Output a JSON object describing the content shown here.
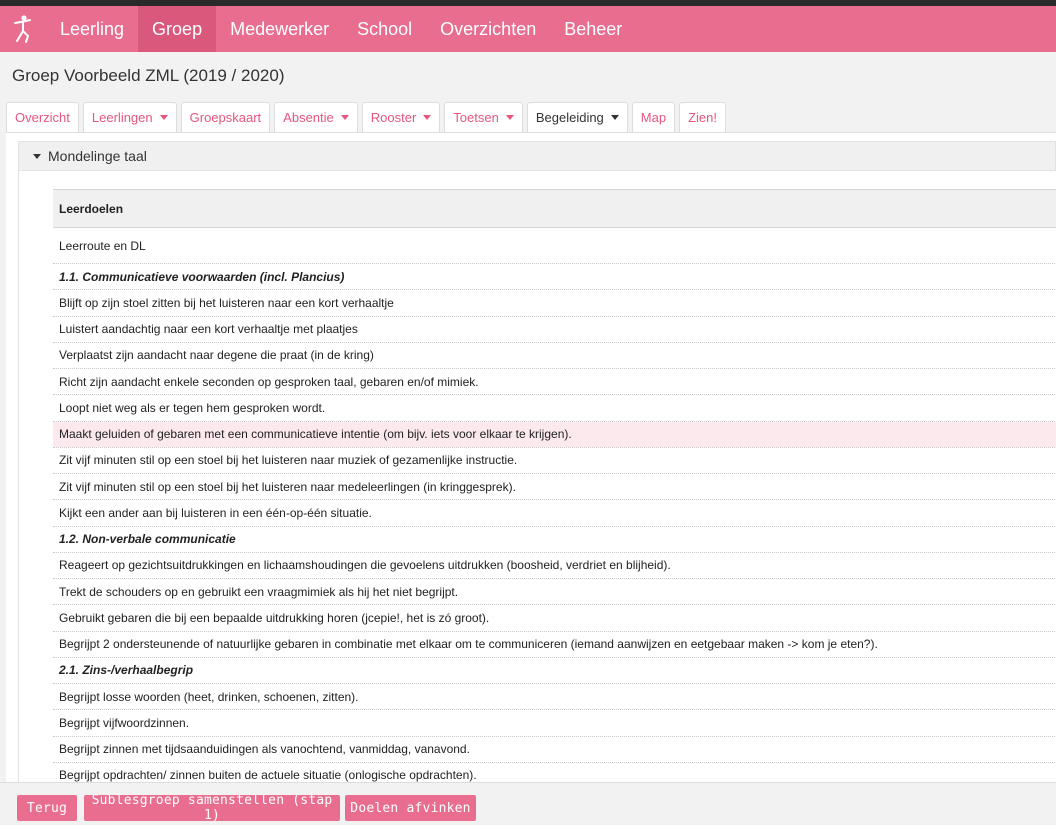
{
  "nav": {
    "items": [
      {
        "label": "Leerling"
      },
      {
        "label": "Groep"
      },
      {
        "label": "Medewerker"
      },
      {
        "label": "School"
      },
      {
        "label": "Overzichten"
      },
      {
        "label": "Beheer"
      }
    ],
    "active_index": 1,
    "accent_color": "#e96d8f",
    "logo_icon": "dancer-icon"
  },
  "page": {
    "title": "Groep Voorbeeld ZML (2019 / 2020)"
  },
  "tabs": [
    {
      "label": "Overzicht",
      "dropdown": false
    },
    {
      "label": "Leerlingen",
      "dropdown": true
    },
    {
      "label": "Groepskaart",
      "dropdown": false
    },
    {
      "label": "Absentie",
      "dropdown": true
    },
    {
      "label": "Rooster",
      "dropdown": true
    },
    {
      "label": "Toetsen",
      "dropdown": true
    },
    {
      "label": "Begeleiding",
      "dropdown": true,
      "active": true
    },
    {
      "label": "Map",
      "dropdown": false
    },
    {
      "label": "Zien!",
      "dropdown": false
    }
  ],
  "panel": {
    "title": "Mondelinge taal",
    "table_header": "Leerdoelen",
    "rows": [
      {
        "text": "Leerroute en DL",
        "type": "normal"
      },
      {
        "text": "1.1. Communicatieve voorwaarden (incl. Plancius)",
        "type": "section"
      },
      {
        "text": "Blijft op zijn stoel zitten bij het luisteren naar een kort verhaaltje",
        "type": "normal"
      },
      {
        "text": "Luistert aandachtig naar een kort verhaaltje met plaatjes",
        "type": "normal"
      },
      {
        "text": "Verplaatst zijn aandacht naar degene die praat (in de kring)",
        "type": "normal"
      },
      {
        "text": "Richt zijn aandacht enkele seconden op gesproken taal, gebaren en/of mimiek.",
        "type": "normal"
      },
      {
        "text": "Loopt niet weg als er tegen hem gesproken wordt.",
        "type": "normal"
      },
      {
        "text": "Maakt geluiden of gebaren met een communicatieve intentie (om bijv. iets voor elkaar te krijgen).",
        "type": "highlight"
      },
      {
        "text": "Zit vijf minuten stil op een stoel bij het luisteren naar muziek of gezamenlijke instructie.",
        "type": "normal"
      },
      {
        "text": "Zit vijf minuten stil op een stoel bij het luisteren naar medeleerlingen (in kringgesprek).",
        "type": "normal"
      },
      {
        "text": "Kijkt een ander aan bij luisteren in een één-op-één situatie.",
        "type": "normal"
      },
      {
        "text": "1.2. Non-verbale communicatie",
        "type": "section"
      },
      {
        "text": "Reageert op gezichtsuitdrukkingen en lichaamshoudingen die gevoelens uitdrukken (boosheid, verdriet en blijheid).",
        "type": "normal"
      },
      {
        "text": "Trekt de schouders op en gebruikt een vraagmimiek als hij het niet begrijpt.",
        "type": "normal"
      },
      {
        "text": "Gebruikt gebaren die bij een bepaalde uitdrukking horen (jcepie!, het is zó groot).",
        "type": "normal"
      },
      {
        "text": "Begrijpt 2 ondersteunende of natuurlijke gebaren in combinatie met elkaar om te communiceren (iemand aanwijzen en eetgebaar maken -> kom je eten?).",
        "type": "normal"
      },
      {
        "text": "2.1. Zins-/verhaalbegrip",
        "type": "section"
      },
      {
        "text": "Begrijpt losse woorden (heet, drinken, schoenen, zitten).",
        "type": "normal"
      },
      {
        "text": "Begrijpt vijfwoordzinnen.",
        "type": "normal"
      },
      {
        "text": "Begrijpt zinnen met tijdsaanduidingen als vanochtend, vanmiddag, vanavond.",
        "type": "normal"
      },
      {
        "text": "Begrijpt opdrachten/ zinnen buiten de actuele situatie (onlogische opdrachten).",
        "type": "normal"
      }
    ]
  },
  "footer": {
    "back_label": "Terug",
    "compose_label": "Sublesgroep samenstellen (stap 1)",
    "check_label": "Doelen afvinken"
  }
}
